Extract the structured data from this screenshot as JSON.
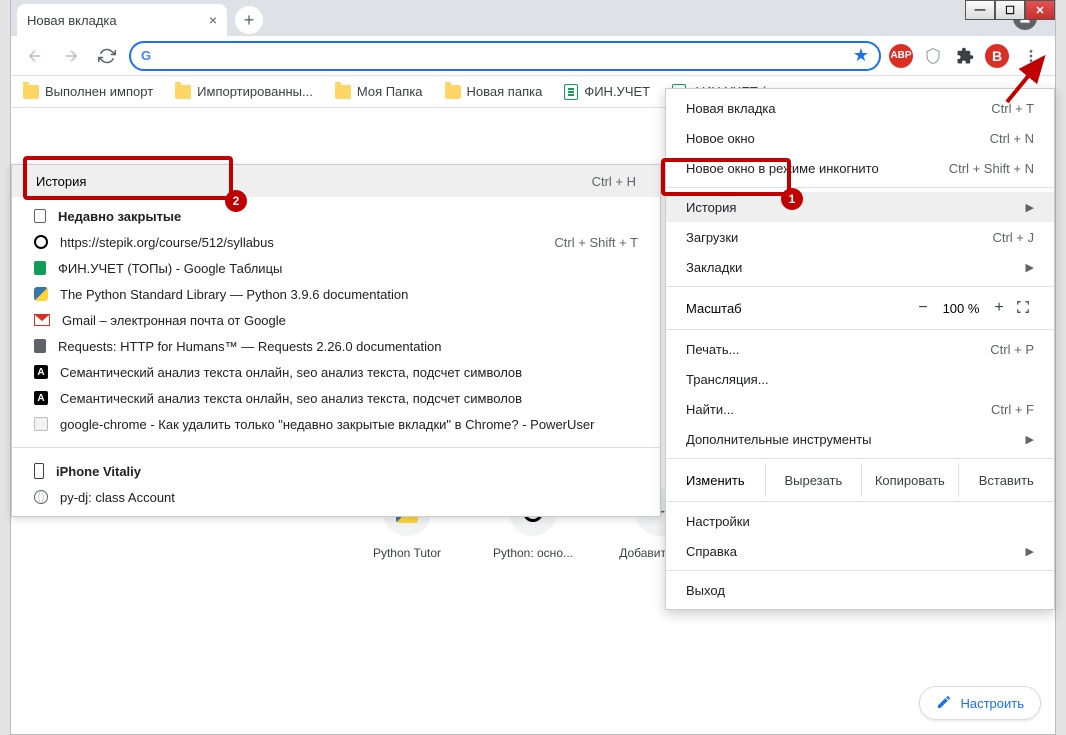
{
  "window": {
    "tab_title": "Новая вкладка",
    "avatar_letter": "B"
  },
  "bookmarks": [
    {
      "label": "Выполнен импорт",
      "type": "folder"
    },
    {
      "label": "Импортированны...",
      "type": "folder"
    },
    {
      "label": "Моя Папка",
      "type": "folder"
    },
    {
      "label": "Новая папка",
      "type": "folder"
    },
    {
      "label": "ФИН.УЧЕТ",
      "type": "sheet"
    },
    {
      "label": "ФИН.УЧЕТ (...",
      "type": "sheet"
    }
  ],
  "history_panel": {
    "header": {
      "label": "История",
      "shortcut": "Ctrl + H"
    },
    "recent_header": "Недавно закрытые",
    "recent_shortcut": "Ctrl + Shift + T",
    "recent": [
      {
        "icon": "stepik",
        "label": "https://stepik.org/course/512/syllabus"
      },
      {
        "icon": "sheets",
        "label": "ФИН.УЧЕТ (ТОПы) - Google Таблицы"
      },
      {
        "icon": "py",
        "label": "The Python Standard Library — Python 3.9.6 documentation"
      },
      {
        "icon": "gmail",
        "label": "Gmail – электронная почта от Google"
      },
      {
        "icon": "req",
        "label": "Requests: HTTP for Humans™ — Requests 2.26.0 documentation"
      },
      {
        "icon": "a",
        "label": "Семантический анализ текста онлайн, seo анализ текста, подсчет символов"
      },
      {
        "icon": "a",
        "label": "Семантический анализ текста онлайн, seo анализ текста, подсчет символов"
      },
      {
        "icon": "se",
        "label": "google-chrome - Как удалить только \"недавно закрытые вкладки\" в Chrome? - PowerUser"
      }
    ],
    "device_header": "iPhone Vitaliy",
    "device_item": "py-dj: class Account"
  },
  "main_menu": {
    "items_top": [
      {
        "label": "Новая вкладка",
        "shortcut": "Ctrl + T"
      },
      {
        "label": "Новое окно",
        "shortcut": "Ctrl + N"
      },
      {
        "label": "Новое окно в режиме инкогнито",
        "shortcut": "Ctrl + Shift + N"
      }
    ],
    "history": {
      "label": "История"
    },
    "downloads": {
      "label": "Загрузки",
      "shortcut": "Ctrl + J"
    },
    "bookmarks": {
      "label": "Закладки"
    },
    "zoom": {
      "label": "Масштаб",
      "value": "100 %"
    },
    "print": {
      "label": "Печать...",
      "shortcut": "Ctrl + P"
    },
    "cast": {
      "label": "Трансляция..."
    },
    "find": {
      "label": "Найти...",
      "shortcut": "Ctrl + F"
    },
    "more_tools": {
      "label": "Дополнительные инструменты"
    },
    "edit": {
      "label": "Изменить",
      "cut": "Вырезать",
      "copy": "Копировать",
      "paste": "Вставить"
    },
    "settings": {
      "label": "Настройки"
    },
    "help": {
      "label": "Справка"
    },
    "exit": {
      "label": "Выход"
    }
  },
  "shortcuts_row": [
    {
      "label": "Python Tutor",
      "icon": "py"
    },
    {
      "label": "Python: осно...",
      "icon": "stepik"
    },
    {
      "label": "Добавить яр...",
      "icon": "plus"
    }
  ],
  "customize_label": "Настроить",
  "annotations": {
    "badge1": "1",
    "badge2": "2"
  }
}
